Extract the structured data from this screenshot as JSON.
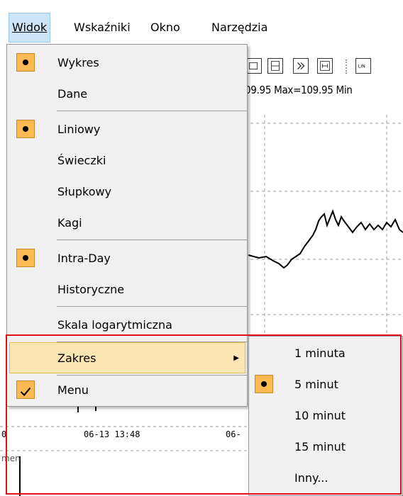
{
  "menubar": {
    "items": [
      {
        "label": "Widok",
        "mnemonic_index": 0
      },
      {
        "label": "Wskaźniki",
        "mnemonic_index": 1
      },
      {
        "label": "Okno",
        "mnemonic_index": 0
      },
      {
        "label": "Narzędzia",
        "mnemonic_index": 0
      }
    ]
  },
  "background": {
    "info_text": "09.95 Max=109.95 Min",
    "time_labels": [
      "0",
      "06-13 13:48",
      "06-"
    ],
    "bottom_text": "men"
  },
  "menu": {
    "items": [
      {
        "label": "Wykres",
        "checked": "bullet"
      },
      {
        "label": "Dane",
        "checked": "none"
      },
      {
        "label": "Liniowy",
        "checked": "bullet"
      },
      {
        "label": "Świeczki",
        "checked": "none"
      },
      {
        "label": "Słupkowy",
        "checked": "none"
      },
      {
        "label": "Kagi",
        "checked": "none"
      },
      {
        "label": "Intra-Day",
        "checked": "bullet"
      },
      {
        "label": "Historyczne",
        "checked": "none"
      },
      {
        "label": "Skala logarytmiczna",
        "checked": "none"
      },
      {
        "label": "Zakres",
        "checked": "none",
        "has_submenu": true,
        "highlighted": true
      },
      {
        "label": "Menu",
        "checked": "checkmark"
      }
    ]
  },
  "submenu": {
    "items": [
      {
        "label": "1 minuta",
        "checked": "none"
      },
      {
        "label": "5 minut",
        "checked": "bullet"
      },
      {
        "label": "10 minut",
        "checked": "none"
      },
      {
        "label": "15 minut",
        "checked": "none"
      },
      {
        "label": "Inny...",
        "checked": "none"
      }
    ]
  },
  "colors": {
    "check_fill": "#fcb954",
    "highlight_fill": "#fbe5b0",
    "annotation_border": "#e0101a"
  }
}
